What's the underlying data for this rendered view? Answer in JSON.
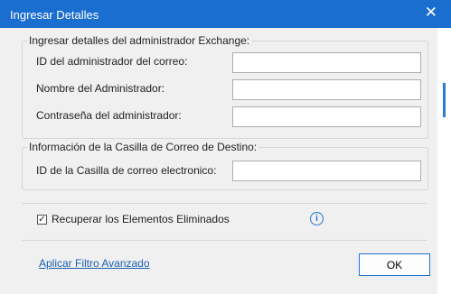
{
  "window": {
    "title": "Ingresar Detalles",
    "close_glyph": "✕"
  },
  "admin_group": {
    "legend": "Ingresar detalles del administrador Exchange:",
    "fields": [
      {
        "label": "ID del administrador del correo:",
        "value": "",
        "placeholder": ""
      },
      {
        "label": "Nombre del Administrador:",
        "value": "",
        "placeholder": ""
      },
      {
        "label": "Contraseña del administrador:",
        "value": "",
        "placeholder": ""
      }
    ]
  },
  "mailbox_group": {
    "legend": "Información de la Casilla de Correo de Destino:",
    "field": {
      "label": "ID de la Casilla de correo electronico:",
      "value": "",
      "placeholder": ""
    }
  },
  "options": {
    "recover_deleted": {
      "label": "Recuperar los Elementos Eliminados",
      "checked": true,
      "check_glyph": "✓"
    },
    "info_glyph": "i"
  },
  "footer": {
    "link_label": "Aplicar Filtro Avanzado",
    "ok_label": "OK"
  },
  "icons": {
    "close": "close-icon",
    "info": "info-icon",
    "check": "checkbox-checked-icon"
  },
  "colors": {
    "titlebar": "#1a6ed0",
    "accent": "#1e73d2",
    "link": "#1a5fb4"
  }
}
